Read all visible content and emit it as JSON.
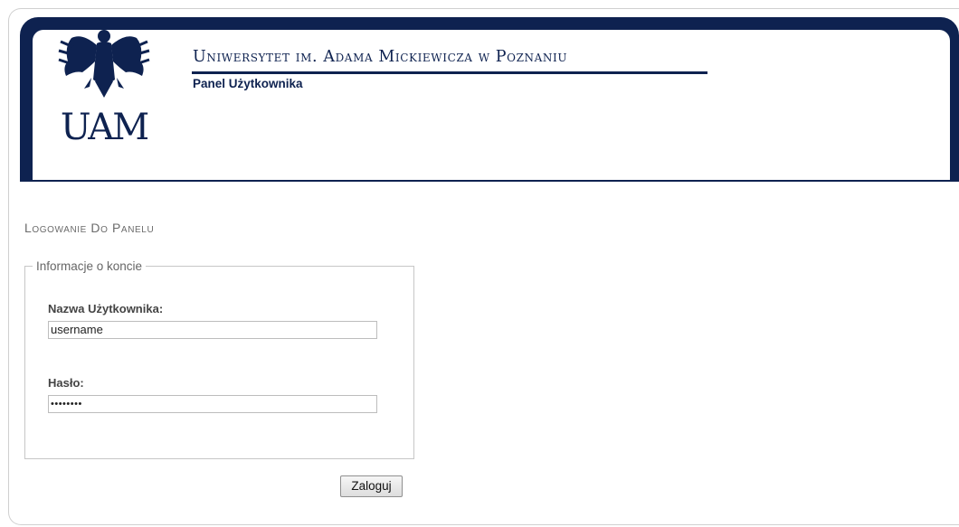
{
  "header": {
    "university_name_first_letters": [
      "U",
      "I",
      "A",
      "M",
      "W",
      "P"
    ],
    "university_name": "Uniwersytet im. Adama Mickiewicza w Poznaniu",
    "panel_title": "Panel Użytkownika",
    "logo_text": "UAM",
    "brand_color": "#0e2250"
  },
  "page": {
    "section_title": "Logowanie Do Panelu"
  },
  "form": {
    "legend": "Informacje o koncie",
    "username_label": "Nazwa Użytkownika:",
    "username_value": "username",
    "password_label": "Hasło:",
    "password_value": "••••••••",
    "submit_label": "Zaloguj"
  }
}
